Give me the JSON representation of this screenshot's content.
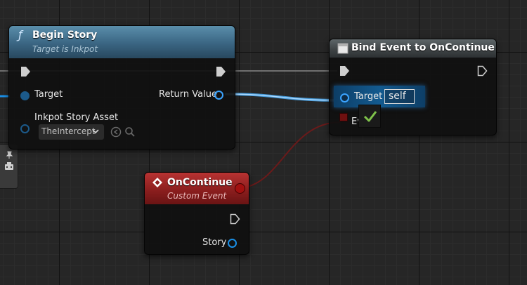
{
  "colors": {
    "exec": "#ffffff",
    "object_pin": "#3ba4ff",
    "delegate_pin": "#8a1414",
    "wire_object": "#4ab0ff",
    "wire_delegate": "#7a1e1e"
  },
  "begin_story": {
    "title": "Begin Story",
    "subtitle": "Target is Inkpot",
    "function_icon": "ƒ",
    "target_label": "Target",
    "return_label": "Return Value",
    "asset_label": "Inkpot Story Asset",
    "asset_value": "TheIntercept",
    "icons": [
      "chevron-down-icon",
      "use-selected-icon",
      "browse-icon"
    ]
  },
  "bind_event": {
    "title": "Bind Event to OnContinue",
    "target_label": "Target",
    "target_value": "self",
    "event_label": "Ev",
    "icons": [
      "node-icon",
      "checkmark-icon"
    ]
  },
  "on_continue": {
    "title": "OnContinue",
    "subtitle": "Custom Event",
    "story_label": "Story",
    "icons": [
      "event-diamond-icon"
    ]
  }
}
